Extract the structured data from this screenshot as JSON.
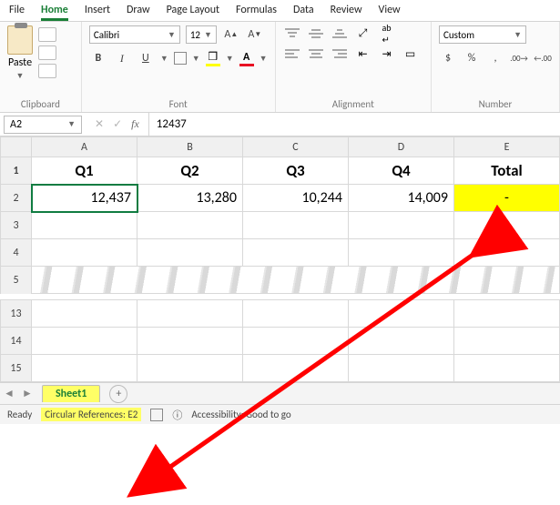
{
  "tabs": [
    "File",
    "Home",
    "Insert",
    "Draw",
    "Page Layout",
    "Formulas",
    "Data",
    "Review",
    "View"
  ],
  "active_tab": "Home",
  "ribbon": {
    "clipboard": {
      "label": "Clipboard",
      "paste": "Paste"
    },
    "font": {
      "label": "Font",
      "name": "Calibri",
      "size": "12"
    },
    "alignment": {
      "label": "Alignment"
    },
    "number": {
      "label": "Number",
      "format": "Custom"
    }
  },
  "namebox": "A2",
  "formula_bar": "12437",
  "columns": [
    "A",
    "B",
    "C",
    "D",
    "E"
  ],
  "rows_top": [
    "1",
    "2",
    "3",
    "4",
    "5"
  ],
  "rows_bottom": [
    "13",
    "14",
    "15"
  ],
  "headers": {
    "A": "Q1",
    "B": "Q2",
    "C": "Q3",
    "D": "Q4",
    "E": "Total"
  },
  "values": {
    "A": "12,437",
    "B": "13,280",
    "C": "10,244",
    "D": "14,009",
    "E": "-"
  },
  "sheet_tab": "Sheet1",
  "status": {
    "ready": "Ready",
    "circular": "Circular References: E2",
    "accessibility": "Accessibility: Good to go"
  }
}
